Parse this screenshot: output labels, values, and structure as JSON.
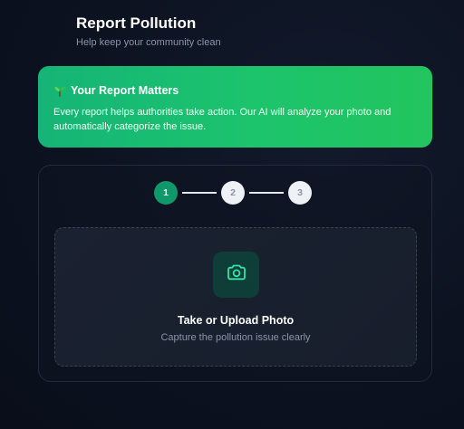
{
  "header": {
    "title": "Report Pollution",
    "subtitle": "Help keep your community clean"
  },
  "banner": {
    "icon": "sprout-icon",
    "title": "Your Report Matters",
    "text": "Every report helps authorities take action. Our AI will analyze your photo and automatically categorize the issue.",
    "gradient_start": "#15b477",
    "gradient_end": "#22c55e"
  },
  "stepper": {
    "steps": [
      {
        "label": "1",
        "state": "active"
      },
      {
        "label": "2",
        "state": "inactive"
      },
      {
        "label": "3",
        "state": "inactive"
      }
    ],
    "active_color": "#10986a"
  },
  "upload": {
    "icon": "camera-icon",
    "title": "Take or Upload Photo",
    "subtitle": "Capture the pollution issue clearly"
  }
}
